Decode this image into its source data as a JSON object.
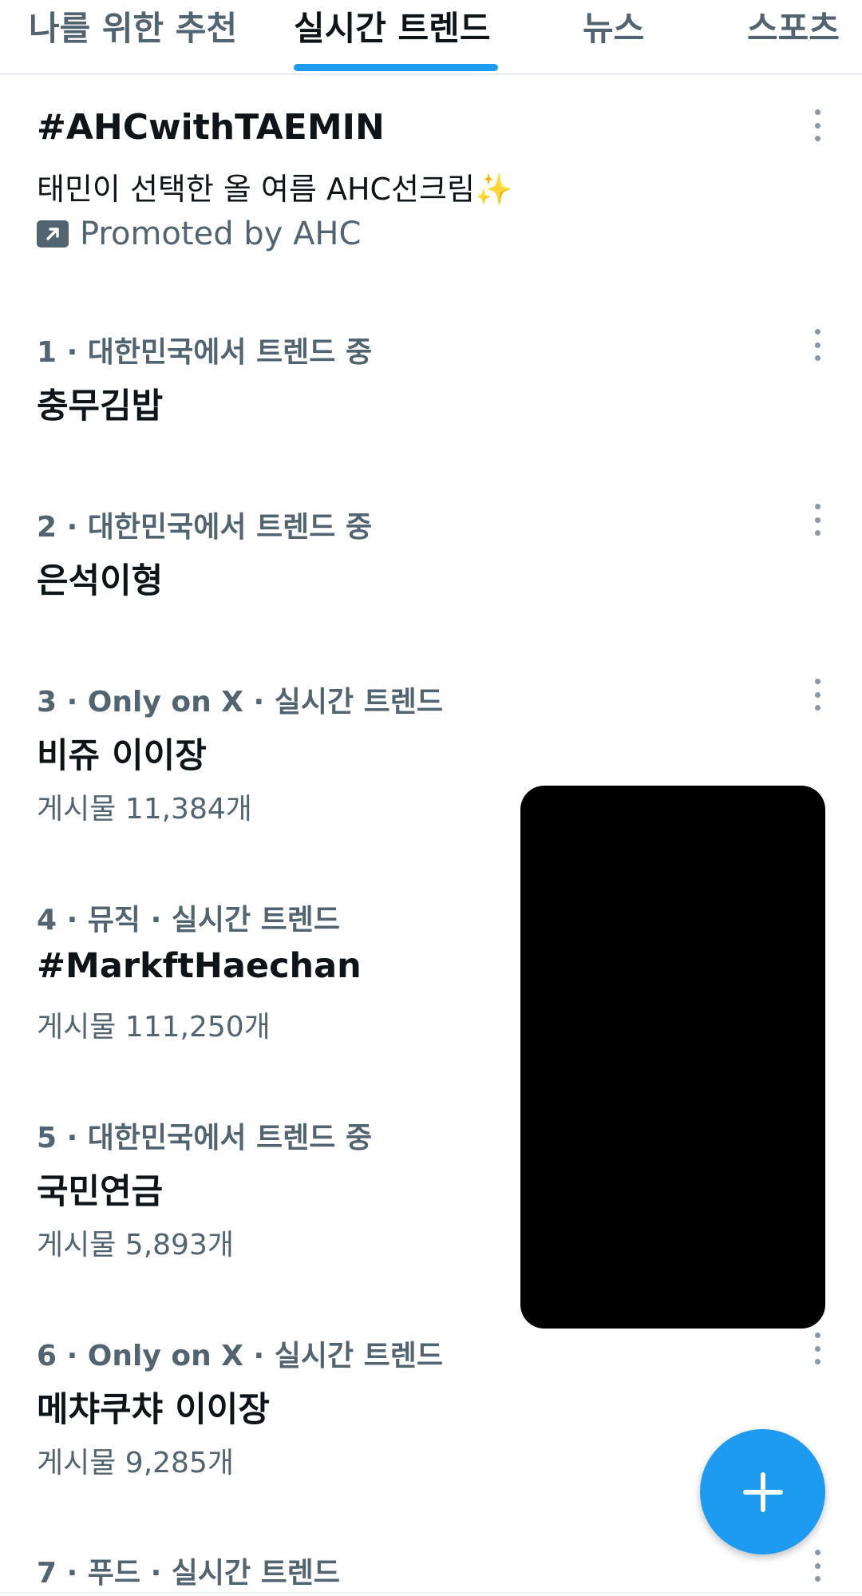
{
  "tabs": [
    {
      "label": "나를 위한 추천"
    },
    {
      "label": "실시간 트렌드"
    },
    {
      "label": "뉴스"
    },
    {
      "label": "스포츠"
    }
  ],
  "promoted": {
    "title": "#AHCwithTAEMIN",
    "description": "태민이 선택한 올 여름 AHC선크림✨",
    "promoted_by": "Promoted by AHC"
  },
  "trends": [
    {
      "meta": "1 · 대한민국에서 트렌드 중",
      "title": "충무김밥",
      "posts": ""
    },
    {
      "meta": "2 · 대한민국에서 트렌드 중",
      "title": "은석이형",
      "posts": ""
    },
    {
      "meta": "3 · Only on X · 실시간 트렌드",
      "title": "비쥬 이이장",
      "posts": "게시물 11,384개"
    },
    {
      "meta": "4 · 뮤직 · 실시간 트렌드",
      "title": "#MarkftHaechan",
      "posts": "게시물 111,250개"
    },
    {
      "meta": "5 · 대한민국에서 트렌드 중",
      "title": "국민연금",
      "posts": "게시물 5,893개"
    },
    {
      "meta": "6 · Only on X · 실시간 트렌드",
      "title": "메챠쿠챠 이이장",
      "posts": "게시물 9,285개"
    },
    {
      "meta": "7 · 푸드 · 실시간 트렌드",
      "title": "",
      "posts": ""
    }
  ],
  "icons": {
    "more": "more-vertical-icon",
    "promoted": "promoted-arrow-icon",
    "compose": "plus-icon"
  },
  "colors": {
    "accent": "#1d9bf0",
    "text_primary": "#0f1419",
    "text_secondary": "#536471"
  }
}
